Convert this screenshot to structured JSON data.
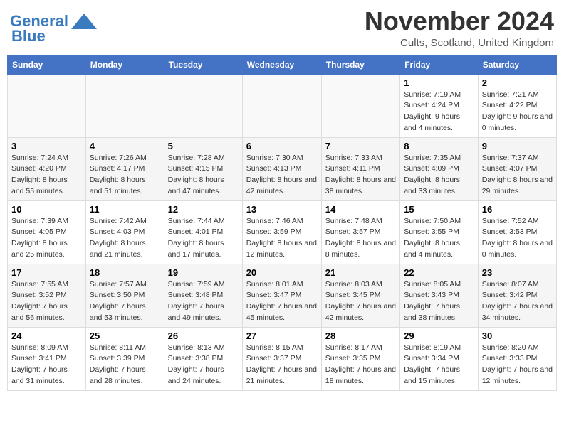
{
  "header": {
    "logo_line1": "General",
    "logo_line2": "Blue",
    "month_title": "November 2024",
    "subtitle": "Cults, Scotland, United Kingdom"
  },
  "weekdays": [
    "Sunday",
    "Monday",
    "Tuesday",
    "Wednesday",
    "Thursday",
    "Friday",
    "Saturday"
  ],
  "weeks": [
    [
      {
        "day": "",
        "sunrise": "",
        "sunset": "",
        "daylight": ""
      },
      {
        "day": "",
        "sunrise": "",
        "sunset": "",
        "daylight": ""
      },
      {
        "day": "",
        "sunrise": "",
        "sunset": "",
        "daylight": ""
      },
      {
        "day": "",
        "sunrise": "",
        "sunset": "",
        "daylight": ""
      },
      {
        "day": "",
        "sunrise": "",
        "sunset": "",
        "daylight": ""
      },
      {
        "day": "1",
        "sunrise": "Sunrise: 7:19 AM",
        "sunset": "Sunset: 4:24 PM",
        "daylight": "Daylight: 9 hours and 4 minutes."
      },
      {
        "day": "2",
        "sunrise": "Sunrise: 7:21 AM",
        "sunset": "Sunset: 4:22 PM",
        "daylight": "Daylight: 9 hours and 0 minutes."
      }
    ],
    [
      {
        "day": "3",
        "sunrise": "Sunrise: 7:24 AM",
        "sunset": "Sunset: 4:20 PM",
        "daylight": "Daylight: 8 hours and 55 minutes."
      },
      {
        "day": "4",
        "sunrise": "Sunrise: 7:26 AM",
        "sunset": "Sunset: 4:17 PM",
        "daylight": "Daylight: 8 hours and 51 minutes."
      },
      {
        "day": "5",
        "sunrise": "Sunrise: 7:28 AM",
        "sunset": "Sunset: 4:15 PM",
        "daylight": "Daylight: 8 hours and 47 minutes."
      },
      {
        "day": "6",
        "sunrise": "Sunrise: 7:30 AM",
        "sunset": "Sunset: 4:13 PM",
        "daylight": "Daylight: 8 hours and 42 minutes."
      },
      {
        "day": "7",
        "sunrise": "Sunrise: 7:33 AM",
        "sunset": "Sunset: 4:11 PM",
        "daylight": "Daylight: 8 hours and 38 minutes."
      },
      {
        "day": "8",
        "sunrise": "Sunrise: 7:35 AM",
        "sunset": "Sunset: 4:09 PM",
        "daylight": "Daylight: 8 hours and 33 minutes."
      },
      {
        "day": "9",
        "sunrise": "Sunrise: 7:37 AM",
        "sunset": "Sunset: 4:07 PM",
        "daylight": "Daylight: 8 hours and 29 minutes."
      }
    ],
    [
      {
        "day": "10",
        "sunrise": "Sunrise: 7:39 AM",
        "sunset": "Sunset: 4:05 PM",
        "daylight": "Daylight: 8 hours and 25 minutes."
      },
      {
        "day": "11",
        "sunrise": "Sunrise: 7:42 AM",
        "sunset": "Sunset: 4:03 PM",
        "daylight": "Daylight: 8 hours and 21 minutes."
      },
      {
        "day": "12",
        "sunrise": "Sunrise: 7:44 AM",
        "sunset": "Sunset: 4:01 PM",
        "daylight": "Daylight: 8 hours and 17 minutes."
      },
      {
        "day": "13",
        "sunrise": "Sunrise: 7:46 AM",
        "sunset": "Sunset: 3:59 PM",
        "daylight": "Daylight: 8 hours and 12 minutes."
      },
      {
        "day": "14",
        "sunrise": "Sunrise: 7:48 AM",
        "sunset": "Sunset: 3:57 PM",
        "daylight": "Daylight: 8 hours and 8 minutes."
      },
      {
        "day": "15",
        "sunrise": "Sunrise: 7:50 AM",
        "sunset": "Sunset: 3:55 PM",
        "daylight": "Daylight: 8 hours and 4 minutes."
      },
      {
        "day": "16",
        "sunrise": "Sunrise: 7:52 AM",
        "sunset": "Sunset: 3:53 PM",
        "daylight": "Daylight: 8 hours and 0 minutes."
      }
    ],
    [
      {
        "day": "17",
        "sunrise": "Sunrise: 7:55 AM",
        "sunset": "Sunset: 3:52 PM",
        "daylight": "Daylight: 7 hours and 56 minutes."
      },
      {
        "day": "18",
        "sunrise": "Sunrise: 7:57 AM",
        "sunset": "Sunset: 3:50 PM",
        "daylight": "Daylight: 7 hours and 53 minutes."
      },
      {
        "day": "19",
        "sunrise": "Sunrise: 7:59 AM",
        "sunset": "Sunset: 3:48 PM",
        "daylight": "Daylight: 7 hours and 49 minutes."
      },
      {
        "day": "20",
        "sunrise": "Sunrise: 8:01 AM",
        "sunset": "Sunset: 3:47 PM",
        "daylight": "Daylight: 7 hours and 45 minutes."
      },
      {
        "day": "21",
        "sunrise": "Sunrise: 8:03 AM",
        "sunset": "Sunset: 3:45 PM",
        "daylight": "Daylight: 7 hours and 42 minutes."
      },
      {
        "day": "22",
        "sunrise": "Sunrise: 8:05 AM",
        "sunset": "Sunset: 3:43 PM",
        "daylight": "Daylight: 7 hours and 38 minutes."
      },
      {
        "day": "23",
        "sunrise": "Sunrise: 8:07 AM",
        "sunset": "Sunset: 3:42 PM",
        "daylight": "Daylight: 7 hours and 34 minutes."
      }
    ],
    [
      {
        "day": "24",
        "sunrise": "Sunrise: 8:09 AM",
        "sunset": "Sunset: 3:41 PM",
        "daylight": "Daylight: 7 hours and 31 minutes."
      },
      {
        "day": "25",
        "sunrise": "Sunrise: 8:11 AM",
        "sunset": "Sunset: 3:39 PM",
        "daylight": "Daylight: 7 hours and 28 minutes."
      },
      {
        "day": "26",
        "sunrise": "Sunrise: 8:13 AM",
        "sunset": "Sunset: 3:38 PM",
        "daylight": "Daylight: 7 hours and 24 minutes."
      },
      {
        "day": "27",
        "sunrise": "Sunrise: 8:15 AM",
        "sunset": "Sunset: 3:37 PM",
        "daylight": "Daylight: 7 hours and 21 minutes."
      },
      {
        "day": "28",
        "sunrise": "Sunrise: 8:17 AM",
        "sunset": "Sunset: 3:35 PM",
        "daylight": "Daylight: 7 hours and 18 minutes."
      },
      {
        "day": "29",
        "sunrise": "Sunrise: 8:19 AM",
        "sunset": "Sunset: 3:34 PM",
        "daylight": "Daylight: 7 hours and 15 minutes."
      },
      {
        "day": "30",
        "sunrise": "Sunrise: 8:20 AM",
        "sunset": "Sunset: 3:33 PM",
        "daylight": "Daylight: 7 hours and 12 minutes."
      }
    ]
  ]
}
